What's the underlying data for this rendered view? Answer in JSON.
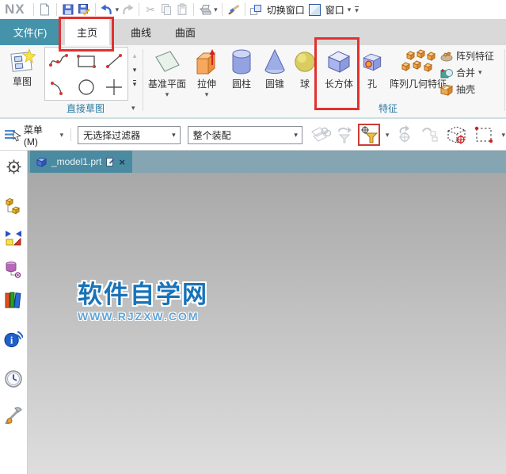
{
  "app": {
    "logo": "NX"
  },
  "titlebar": {
    "switch_window_label": "切换窗口",
    "window_label": "窗口",
    "icons": [
      "new-file",
      "save",
      "save-as",
      "undo",
      "redo",
      "cut",
      "copy",
      "paste",
      "print",
      "format-brush",
      "switch-window",
      "window",
      "customize-quick-access"
    ]
  },
  "ribbon_tabs": {
    "file": "文件(F)",
    "home": "主页",
    "curve": "曲线",
    "surface": "曲面"
  },
  "ribbon": {
    "sketch_button": "草图",
    "direct_sketch_label": "直接草图",
    "feature_label": "特征",
    "gallery_icons": [
      "studio-spline",
      "rectangle",
      "line",
      "arc",
      "circle",
      "point"
    ],
    "features": [
      {
        "label": "基准平面",
        "dropdown": true
      },
      {
        "label": "拉伸",
        "dropdown": true
      },
      {
        "label": "圆柱",
        "dropdown": false
      },
      {
        "label": "圆锥",
        "dropdown": false
      },
      {
        "label": "球",
        "dropdown": false
      },
      {
        "label": "长方体",
        "dropdown": false,
        "highlighted": true
      },
      {
        "label": "孔",
        "dropdown": false
      },
      {
        "label": "阵列几何特征",
        "dropdown": false
      }
    ],
    "small_features": [
      {
        "label": "阵列特征",
        "dropdown": false
      },
      {
        "label": "合并",
        "dropdown": true
      },
      {
        "label": "抽壳",
        "dropdown": false
      }
    ]
  },
  "selection_bar": {
    "menu_label": "菜单(M)",
    "filter_dropdown_value": "无选择过滤器",
    "scope_dropdown_value": "整个装配",
    "icons": [
      "highlight-related",
      "filter-back",
      "snap-point-filter",
      "reset-orient",
      "sequence",
      "bounded-cube-select",
      "rectangle-select"
    ]
  },
  "part_tab": {
    "name": "_model1.prt"
  },
  "watermark": {
    "title": "软件自学网",
    "url": "WWW.RJZXW.COM"
  },
  "sidebar_icons": [
    "navigator-gear",
    "assembly-navigator",
    "constraint-navigator",
    "database-navigator",
    "reuse-library",
    "hd3d-info",
    "history",
    "roles"
  ],
  "colors": {
    "highlight_red": "#e2312d",
    "tab_teal": "#4593ab",
    "group_label_blue": "#2878a0",
    "canvas_top": "#a8a8a8",
    "canvas_bottom": "#dedede",
    "watermark_blue": "#1873b8",
    "watermark_url_blue": "#5fa5d9",
    "part_tab_teal": "#4b8ba1"
  }
}
